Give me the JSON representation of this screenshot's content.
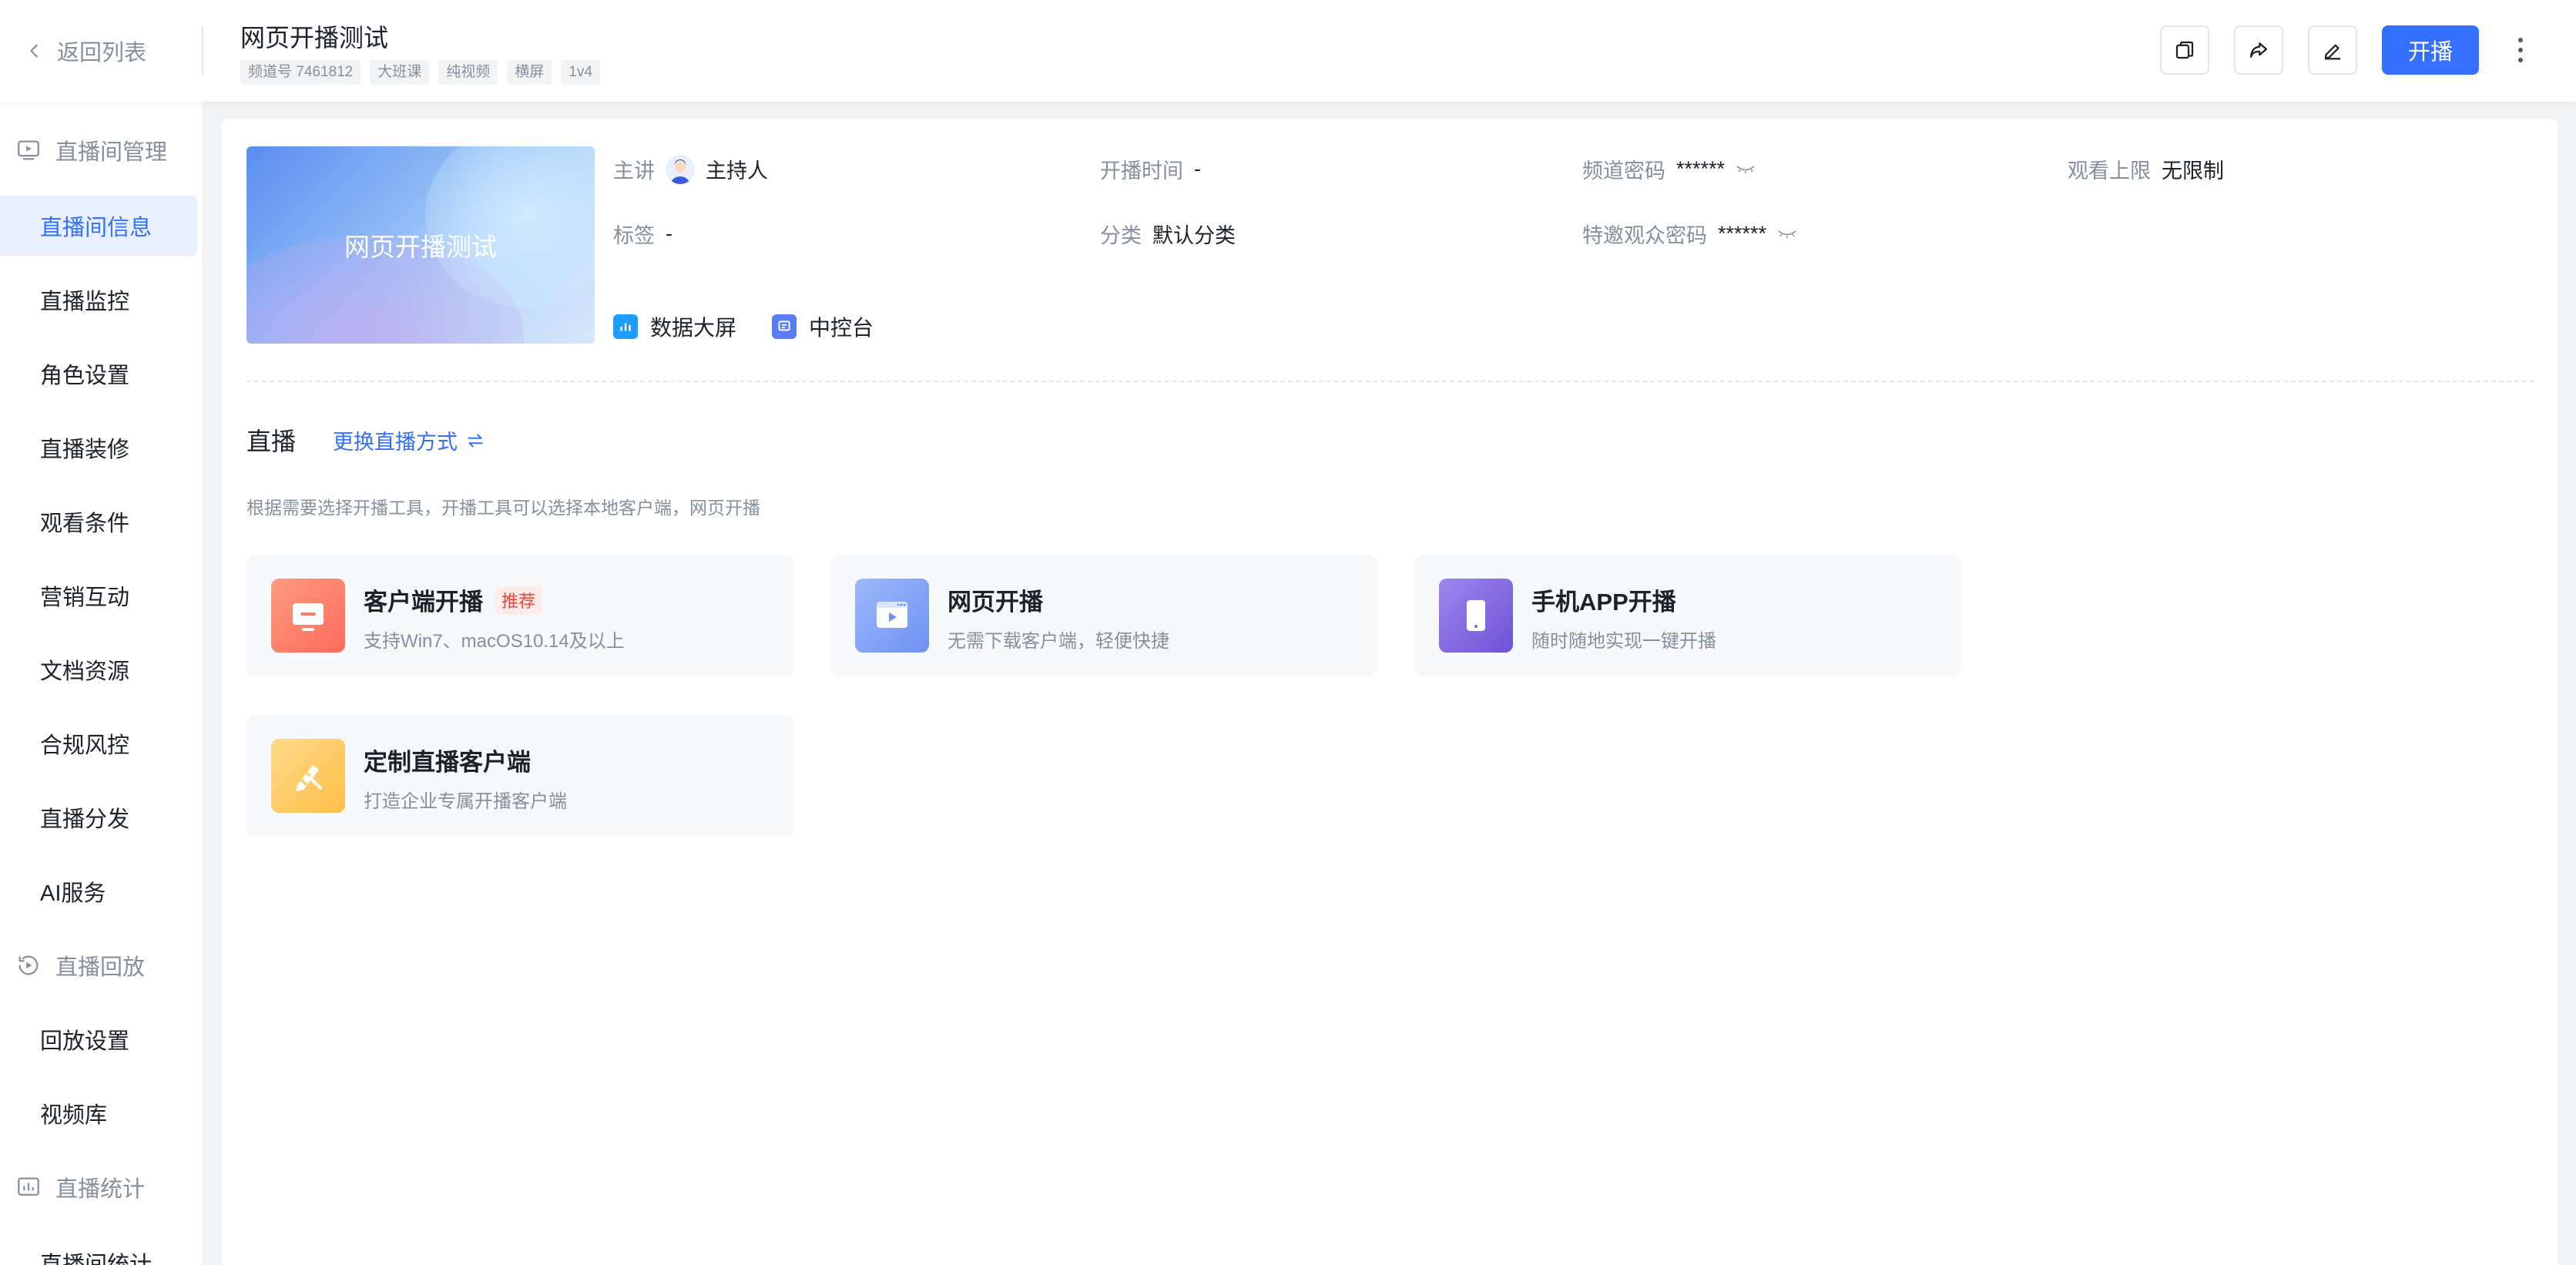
{
  "header": {
    "back_label": "返回列表",
    "title": "网页开播测试",
    "tags": [
      "频道号 7461812",
      "大班课",
      "纯视频",
      "横屏",
      "1v4"
    ],
    "start_button": "开播"
  },
  "sidebar": {
    "group_manage": "直播间管理",
    "items_manage": [
      "直播间信息",
      "直播监控",
      "角色设置",
      "直播装修",
      "观看条件",
      "营销互动",
      "文档资源",
      "合规风控",
      "直播分发",
      "AI服务"
    ],
    "group_replay": "直播回放",
    "items_replay": [
      "回放设置",
      "视频库"
    ],
    "group_stats": "直播统计",
    "items_stats": [
      "直播间统计"
    ]
  },
  "room": {
    "cover_title": "网页开播测试",
    "presenter_key": "主讲",
    "presenter_value": "主持人",
    "start_time_key": "开播时间",
    "start_time_value": "-",
    "channel_pwd_key": "频道密码",
    "channel_pwd_value": "******",
    "view_limit_key": "观看上限",
    "view_limit_value": "无限制",
    "tag_key": "标签",
    "tag_value": "-",
    "category_key": "分类",
    "category_value": "默认分类",
    "guest_pwd_key": "特邀观众密码",
    "guest_pwd_value": "******",
    "quick_data_screen": "数据大屏",
    "quick_console": "中控台"
  },
  "live": {
    "section_title": "直播",
    "switch_label": "更换直播方式",
    "hint": "根据需要选择开播工具，开播工具可以选择本地客户端，网页开播",
    "cards": [
      {
        "title": "客户端开播",
        "badge": "推荐",
        "desc": "支持Win7、macOS10.14及以上"
      },
      {
        "title": "网页开播",
        "desc": "无需下载客户端，轻便快捷"
      },
      {
        "title": "手机APP开播",
        "desc": "随时随地实现一键开播"
      },
      {
        "title": "定制直播客户端",
        "desc": "打造企业专属开播客户端"
      }
    ]
  },
  "colors": {
    "accent": "#3370ff",
    "badge_red": "#f53f3f",
    "client_icon": "#ff7d6b",
    "web_icon": "#7ea2f7",
    "app_icon": "#8a6ee0",
    "custom_icon": "#ffc95c"
  }
}
